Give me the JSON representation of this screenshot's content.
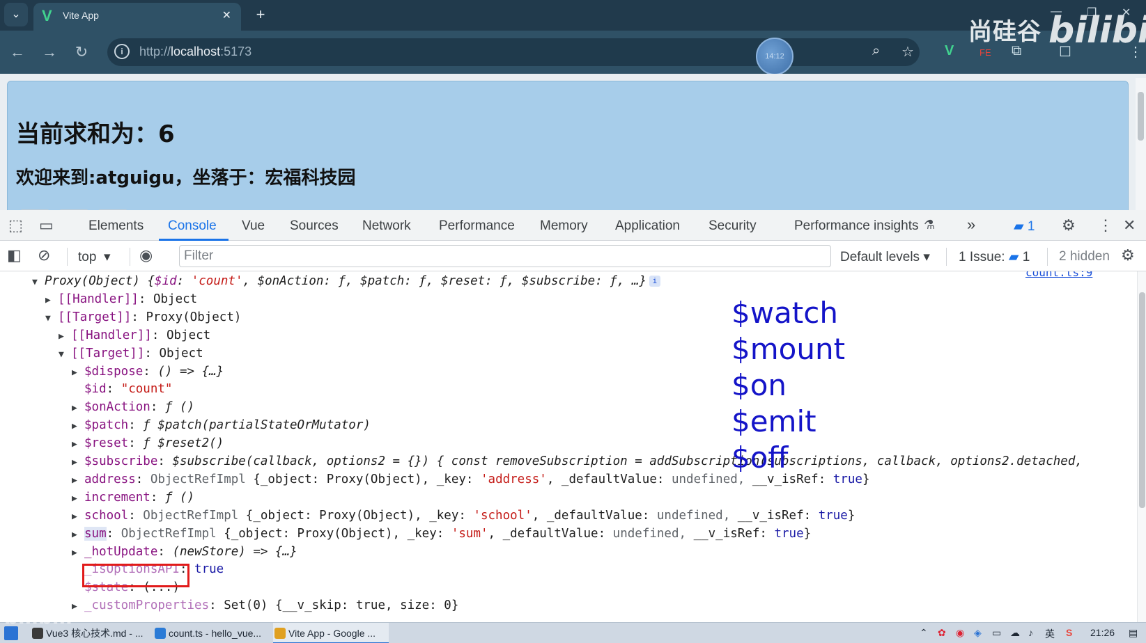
{
  "browser": {
    "tab_title": "Vite App",
    "url_prefix": "http://",
    "url_host": "localhost",
    "url_port": ":5173",
    "timer": "14:12",
    "watermark_brand": "尚硅谷",
    "watermark_site": "bilibili"
  },
  "page": {
    "sum_heading": "当前求和为：6",
    "welcome_text": "欢迎来到:atguigu，坐落于：宏福科技园"
  },
  "devtools": {
    "tabs": [
      "Elements",
      "Console",
      "Vue",
      "Sources",
      "Network",
      "Performance",
      "Memory",
      "Application",
      "Security",
      "Performance insights"
    ],
    "active_tab": "Console",
    "more_tabs": "»",
    "issues_badge_count": "1",
    "context": "top",
    "filter_placeholder": "Filter",
    "levels": "Default levels",
    "issues_label": "1 Issue:",
    "issues_count": "1",
    "hidden_label": "2 hidden",
    "source_link": "count.ts:9"
  },
  "console": {
    "lines": [
      {
        "indent": 0,
        "arrow": "▼",
        "kind": "proxy-summary"
      },
      {
        "indent": 1,
        "arrow": "▶",
        "key": "[[Handler]]",
        "value": "Object"
      },
      {
        "indent": 1,
        "arrow": "▼",
        "key": "[[Target]]",
        "value": "Proxy(Object)"
      },
      {
        "indent": 2,
        "arrow": "▶",
        "key": "[[Handler]]",
        "value": "Object"
      },
      {
        "indent": 2,
        "arrow": "▼",
        "key": "[[Target]]",
        "value": "Object"
      },
      {
        "indent": 3,
        "arrow": "▶",
        "key": "$dispose",
        "value": "() => {…}",
        "vclass": "it"
      },
      {
        "indent": 3,
        "arrow": "",
        "key": "$id",
        "value": "\"count\"",
        "vclass": "str"
      },
      {
        "indent": 3,
        "arrow": "▶",
        "key": "$onAction",
        "value": "ƒ ()",
        "vclass": "it"
      },
      {
        "indent": 3,
        "arrow": "▶",
        "key": "$patch",
        "value": "ƒ $patch(partialStateOrMutator)",
        "vclass": "it"
      },
      {
        "indent": 3,
        "arrow": "▶",
        "key": "$reset",
        "value": "ƒ $reset2()",
        "vclass": "it"
      },
      {
        "indent": 3,
        "arrow": "▶",
        "key": "$subscribe",
        "value": "$subscribe(callback, options2 = {}) { const removeSubscription = addSubscription(subscriptions, callback, options2.detached,",
        "vclass": "it"
      },
      {
        "indent": 3,
        "arrow": "▶",
        "key": "address",
        "kind": "ref",
        "refkey": "'address'"
      },
      {
        "indent": 3,
        "arrow": "▶",
        "key": "increment",
        "value": "ƒ ()",
        "vclass": "it"
      },
      {
        "indent": 3,
        "arrow": "▶",
        "key": "school",
        "kind": "ref",
        "refkey": "'school'"
      },
      {
        "indent": 3,
        "arrow": "▶",
        "key": "sum",
        "kind": "ref",
        "refkey": "'sum'",
        "highlight": true
      },
      {
        "indent": 3,
        "arrow": "▶",
        "key": "_hotUpdate",
        "value": "(newStore) => {…}",
        "vclass": "it"
      },
      {
        "indent": 3,
        "arrow": "",
        "key": "_isOptionsAPI",
        "value": "true",
        "vclass": "kw",
        "fade": true
      },
      {
        "indent": 3,
        "arrow": "",
        "key": "$state",
        "value": "(...)",
        "vclass": "",
        "fade": true
      },
      {
        "indent": 3,
        "arrow": "▶",
        "key": "_customProperties",
        "value": "Set(0) {__v_skip: true, size: 0}",
        "vclass": "",
        "fade": true
      }
    ],
    "proxy_summary": {
      "prefix": "Proxy(Object) {",
      "id_key": "$id",
      "id_val": "'count'",
      "rest": ", $onAction: ƒ, $patch: ƒ, $reset: ƒ, $subscribe: ƒ, …}"
    },
    "ref_template": {
      "type": "ObjectRefImpl",
      "object": "_object: Proxy(Object),",
      "key_label": "_key:",
      "default_label": "_defaultValue:",
      "default_val": "undefined,",
      "isref_label": "__v_isRef:",
      "isref_val": "true"
    }
  },
  "overlay_methods": [
    "$watch",
    "$mount",
    "$on",
    "$emit",
    "$off"
  ],
  "taskbar": {
    "items": [
      {
        "label": "Vue3 核心技术.md - ...",
        "color": "#3a3a3a"
      },
      {
        "label": "count.ts - hello_vue...",
        "color": "#2b7bd6"
      },
      {
        "label": "Vite App - Google ...",
        "color": "#e0a020"
      }
    ],
    "ime": "英",
    "time": "21:26"
  }
}
